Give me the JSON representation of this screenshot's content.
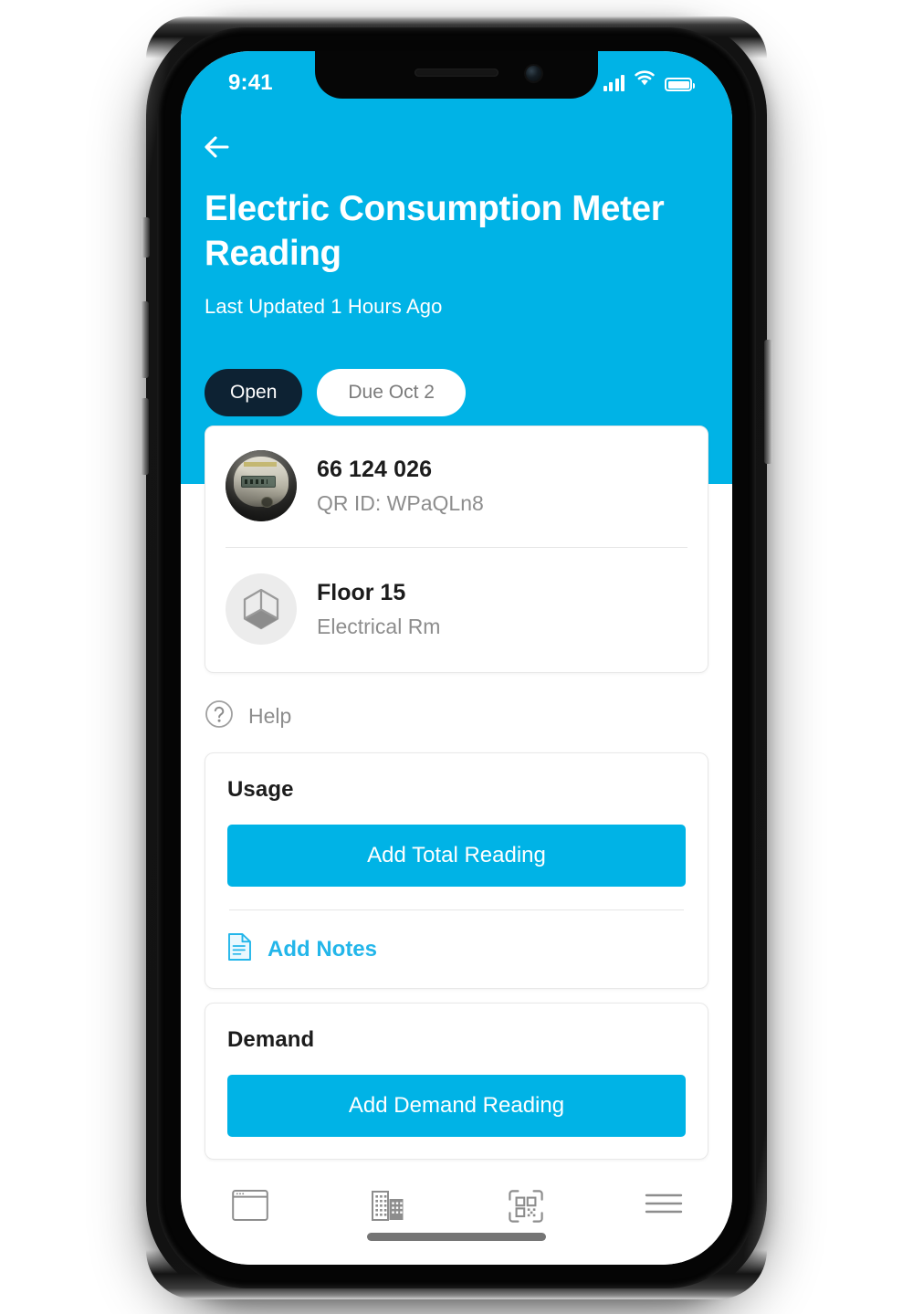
{
  "status_bar": {
    "time": "9:41",
    "signal_icon": "cellular-signal-icon",
    "wifi_icon": "wifi-icon",
    "battery_icon": "battery-full-icon"
  },
  "header": {
    "back_icon": "back-arrow-icon",
    "title": "Electric Consumption Meter Reading",
    "subtitle": "Last Updated 1 Hours Ago",
    "background_color": "#00b3e6",
    "pills": [
      {
        "label": "Open",
        "state": "active",
        "bg": "#0d2233",
        "fg": "#ffffff"
      },
      {
        "label": "Due Oct 2",
        "state": "inactive",
        "bg": "#ffffff",
        "fg": "#7b7b7b"
      }
    ]
  },
  "meter_card": {
    "thumbnail_icon": "electric-meter-photo",
    "meter_number": "66 124 026",
    "qr_id": "QR ID: WPaQLn8",
    "location_icon": "cube-icon",
    "location_name": "Floor 15",
    "location_sub": "Electrical Rm"
  },
  "help": {
    "icon": "question-mark-circle-icon",
    "label": "Help"
  },
  "sections": [
    {
      "title": "Usage",
      "primary_button": "Add Total Reading",
      "notes_icon": "document-icon",
      "notes_label": "Add Notes",
      "accent": "#00b3e6"
    },
    {
      "title": "Demand",
      "primary_button": "Add Demand Reading",
      "accent": "#00b3e6"
    }
  ],
  "bottom_nav": [
    {
      "icon": "window-icon",
      "name": "dashboard"
    },
    {
      "icon": "buildings-icon",
      "name": "buildings"
    },
    {
      "icon": "qr-scan-icon",
      "name": "scan"
    },
    {
      "icon": "hamburger-menu-icon",
      "name": "menu"
    }
  ]
}
